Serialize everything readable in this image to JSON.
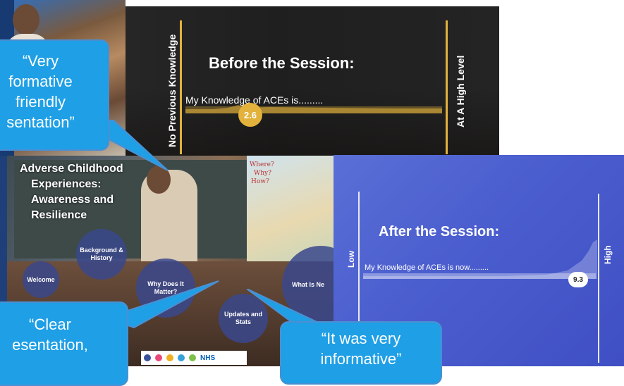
{
  "quotes": {
    "top": [
      "“Very",
      "formative",
      "friendly",
      "sentation”"
    ],
    "bottom_left": [
      "“Clear",
      "esentation,"
    ],
    "bottom_right": [
      "“It was very",
      "informative”"
    ]
  },
  "before_slide": {
    "title": "Before the Session:",
    "low_label": "No Previous Knowledge",
    "high_label": "At A High Level",
    "question": "My Knowledge of ACEs is.........",
    "value": "2.6",
    "accent_color": "#e3b23c"
  },
  "after_slide": {
    "title": "After the Session:",
    "low_label": "Low",
    "high_label": "High",
    "question": "My Knowledge of ACEs is now.........",
    "value": "9.3",
    "background_color": "#4c5fcf"
  },
  "main_slide": {
    "title_lines": [
      "Adverse Childhood",
      "Experiences:",
      "Awareness and",
      "Resilience"
    ],
    "topics": {
      "background": "Background & History",
      "welcome": "Welcome",
      "why": "Why Does It Matter?",
      "updates": "Updates and Stats",
      "whatis": "What Is Ne"
    },
    "board_words": {
      "where": "Where?",
      "why": "Why?",
      "how": "How?"
    },
    "logo_text": "NHS"
  }
}
